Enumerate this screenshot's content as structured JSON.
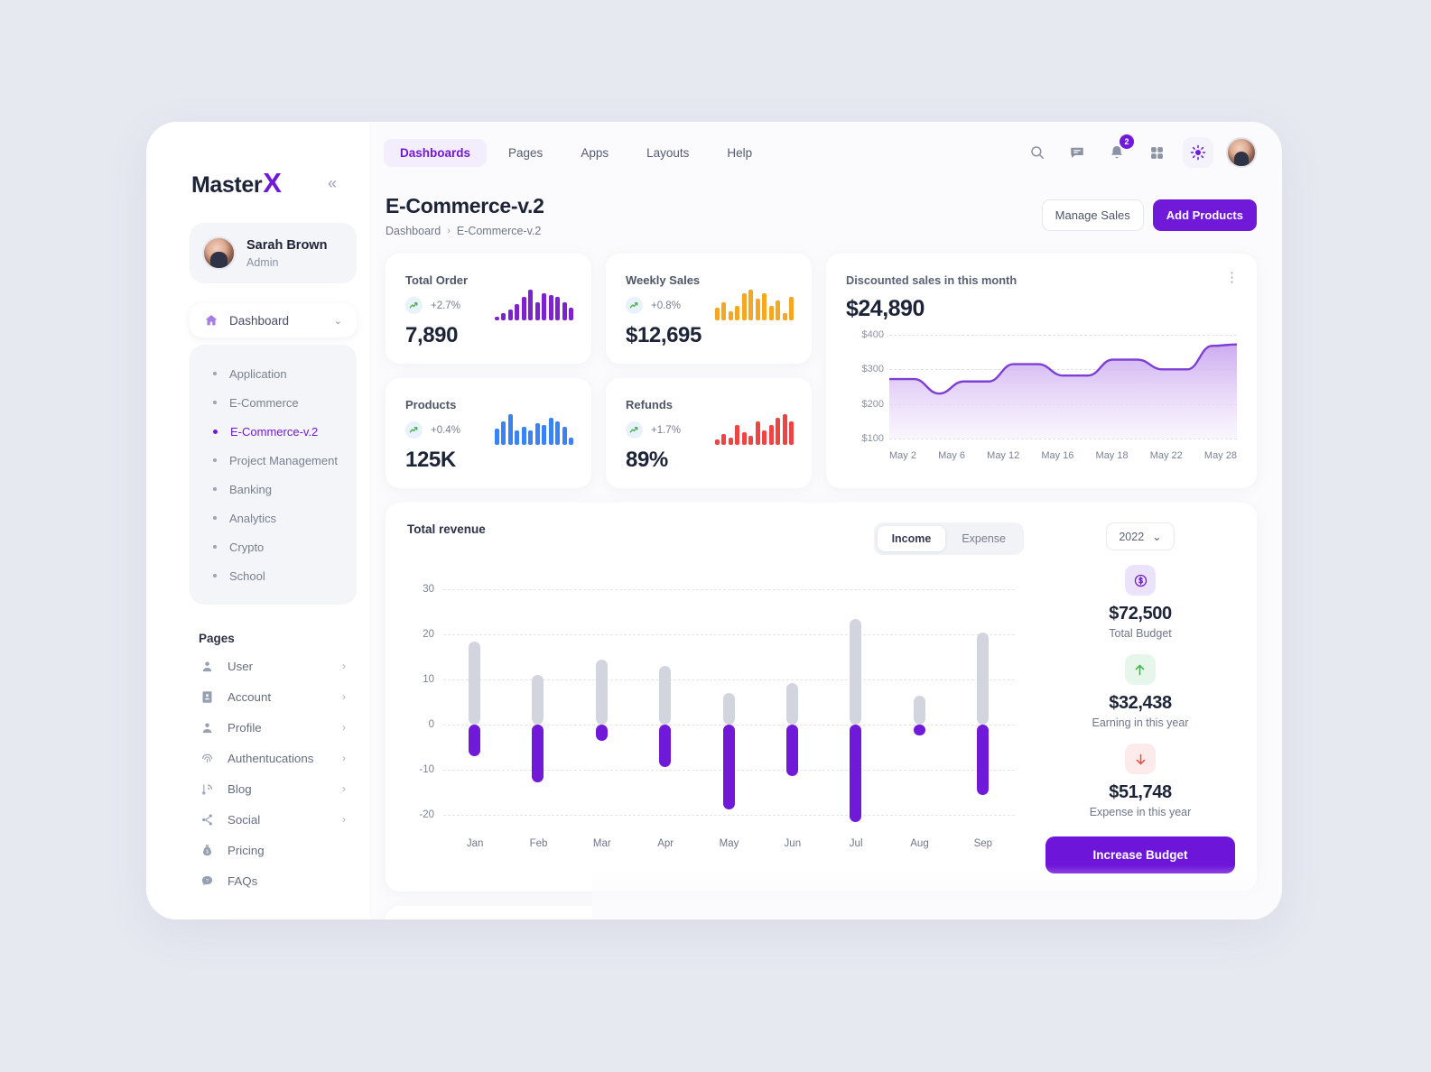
{
  "brand": {
    "name": "Master",
    "accent_letter": "X",
    "collapse_icon": "«"
  },
  "profile": {
    "name": "Sarah Brown",
    "role": "Admin"
  },
  "sidebar": {
    "dashboard_item": {
      "label": "Dashboard",
      "icon": "home-icon",
      "chevron": "⌄"
    },
    "dashboard_children": [
      {
        "label": "Application",
        "active": false
      },
      {
        "label": "E-Commerce",
        "active": false
      },
      {
        "label": "E-Commerce-v.2",
        "active": true
      },
      {
        "label": "Project Management",
        "active": false
      },
      {
        "label": "Banking",
        "active": false
      },
      {
        "label": "Analytics",
        "active": false
      },
      {
        "label": "Crypto",
        "active": false
      },
      {
        "label": "School",
        "active": false
      }
    ],
    "pages_label": "Pages",
    "pages": [
      {
        "label": "User",
        "icon": "user-icon",
        "chevron": "›"
      },
      {
        "label": "Account",
        "icon": "account-card-icon",
        "chevron": "›"
      },
      {
        "label": "Profile",
        "icon": "profile-icon",
        "chevron": "›"
      },
      {
        "label": "Authentucations",
        "icon": "fingerprint-icon",
        "chevron": "›"
      },
      {
        "label": "Blog",
        "icon": "blog-icon",
        "chevron": "›"
      },
      {
        "label": "Social",
        "icon": "share-icon",
        "chevron": "›"
      },
      {
        "label": "Pricing",
        "icon": "money-bag-icon",
        "chevron": ""
      },
      {
        "label": "FAQs",
        "icon": "question-bubble-icon",
        "chevron": ""
      }
    ]
  },
  "topnav": {
    "tabs": [
      {
        "label": "Dashboards",
        "active": true
      },
      {
        "label": "Pages",
        "active": false
      },
      {
        "label": "Apps",
        "active": false
      },
      {
        "label": "Layouts",
        "active": false
      },
      {
        "label": "Help",
        "active": false
      }
    ],
    "icons": [
      "search-icon",
      "message-icon",
      "bell-icon",
      "grid-icon",
      "brightness-icon"
    ],
    "notification_count": "2"
  },
  "header": {
    "title": "E-Commerce-v.2",
    "breadcrumb": [
      "Dashboard",
      "E-Commerce-v.2"
    ],
    "breadcrumb_separator": "›",
    "manage_sales_label": "Manage Sales",
    "add_products_label": "Add Products"
  },
  "stats": [
    {
      "title": "Total Order",
      "delta": "+2.7%",
      "value": "7,890",
      "color": "#7e22ce",
      "spark": [
        4,
        8,
        12,
        18,
        26,
        34,
        20,
        30,
        28,
        26,
        20,
        14
      ]
    },
    {
      "title": "Weekly Sales",
      "delta": "+0.8%",
      "value": "$12,695",
      "color": "#f5a623",
      "spark": [
        14,
        20,
        10,
        16,
        30,
        34,
        24,
        30,
        16,
        22,
        8,
        26
      ]
    },
    {
      "title": "Products",
      "delta": "+0.4%",
      "value": "125K",
      "color": "#3b82f6",
      "spark": [
        18,
        26,
        34,
        16,
        20,
        16,
        24,
        22,
        30,
        26,
        20,
        8
      ]
    },
    {
      "title": "Refunds",
      "delta": "+1.7%",
      "value": "89%",
      "color": "#ef4444",
      "spark": [
        6,
        12,
        8,
        22,
        14,
        10,
        26,
        16,
        22,
        30,
        34,
        26
      ]
    }
  ],
  "discounted": {
    "title": "Discounted sales in this month",
    "value": "$24,890",
    "kebab_icon": "kebab-menu-icon"
  },
  "revenue": {
    "title": "Total revenue",
    "toggle": [
      {
        "label": "Income",
        "on": true
      },
      {
        "label": "Expense",
        "on": false
      }
    ],
    "year": "2022",
    "year_chevron": "⌄",
    "budget": [
      {
        "icon": "dollar-coin-icon",
        "value": "$72,500",
        "label": "Total Budget",
        "tone": "purple",
        "glyph": "$"
      },
      {
        "icon": "arrow-up-icon",
        "value": "$32,438",
        "label": "Earning in this year",
        "tone": "green",
        "glyph": "↑"
      },
      {
        "icon": "arrow-down-icon",
        "value": "$51,748",
        "label": "Expense in this year",
        "tone": "red",
        "glyph": "↓"
      }
    ],
    "increase_budget_label": "Increase Budget"
  },
  "chart_data": [
    {
      "type": "area",
      "title": "Discounted sales in this month",
      "xlabel": "",
      "ylabel": "",
      "ylim": [
        100,
        400
      ],
      "yticks": [
        "$100",
        "$200",
        "$300",
        "$400"
      ],
      "x": [
        "May 2",
        "May 6",
        "May 12",
        "May 16",
        "May 18",
        "May 22",
        "May 28"
      ],
      "xticks": [
        "May 2",
        "May 6",
        "May 12",
        "May 16",
        "May 18",
        "May 22",
        "May 28"
      ],
      "values": [
        272,
        230,
        265,
        315,
        282,
        328,
        300,
        372
      ],
      "series_points": [
        272,
        272,
        230,
        265,
        265,
        315,
        315,
        282,
        282,
        328,
        328,
        300,
        300,
        368,
        372
      ],
      "line_color": "#7e3fd4",
      "fill_gradient": [
        "#c9a7ef",
        "#f6effd"
      ],
      "grid": true,
      "legend": "none"
    },
    {
      "type": "bar",
      "title": "Total revenue",
      "xlabel": "",
      "ylabel": "",
      "ylim": [
        -20,
        30
      ],
      "yticks": [
        30,
        20,
        10,
        0,
        -10,
        -20
      ],
      "categories": [
        "Jan",
        "Feb",
        "Mar",
        "Apr",
        "May",
        "Jun",
        "Jul",
        "Aug",
        "Sep"
      ],
      "series": [
        {
          "name": "Income",
          "color": "#d3d5de",
          "values": [
            18.5,
            11,
            14.5,
            13,
            7,
            9.2,
            23.5,
            6.5,
            20.5
          ]
        },
        {
          "name": "Expense",
          "color": "#7019d9",
          "values": [
            -7,
            -12.7,
            -3.5,
            -9.3,
            -18.8,
            -11.3,
            -21.5,
            -2.4,
            -15.5
          ]
        }
      ],
      "grid": true,
      "legend": "none"
    }
  ]
}
